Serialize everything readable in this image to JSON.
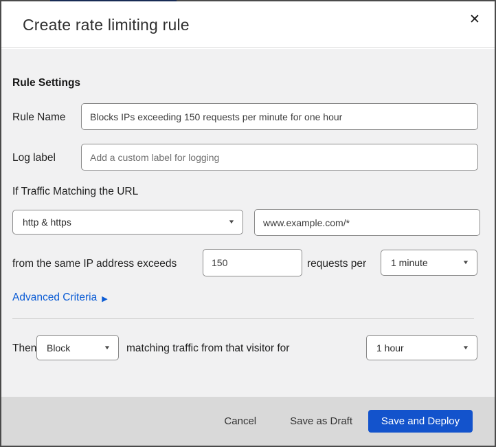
{
  "dialog": {
    "title": "Create rate limiting rule"
  },
  "icons": {
    "close": "✕",
    "caret_down": "▼",
    "arrow_right": "▶"
  },
  "rule_settings": {
    "heading": "Rule Settings",
    "rule_name": {
      "label": "Rule Name",
      "value": "Blocks IPs exceeding 150 requests per minute for one hour"
    },
    "log_label": {
      "label": "Log label",
      "placeholder": "Add a custom label for logging"
    }
  },
  "criteria": {
    "intro": "If Traffic Matching the URL",
    "scheme_select": {
      "selected": "http & https"
    },
    "url_input": {
      "value": "www.example.com/*"
    },
    "threshold_text_before": "from the same IP address exceeds",
    "threshold_input": {
      "value": "150"
    },
    "threshold_text_after": "requests per",
    "period_select": {
      "selected": "1 minute"
    },
    "advanced_link": {
      "label": "Advanced Criteria"
    }
  },
  "action": {
    "then_label": "Then",
    "action_select": {
      "selected": "Block"
    },
    "middle_text": "matching traffic from that visitor for",
    "duration_select": {
      "selected": "1 hour"
    }
  },
  "footer": {
    "cancel": "Cancel",
    "save_draft": "Save as Draft",
    "save_deploy": "Save and Deploy"
  },
  "colors": {
    "accent_top": "#172b54",
    "link_blue": "#0b5cd5",
    "primary_button": "#1353cc",
    "body_bg": "#f1f1f2",
    "footer_bg": "#d9d9d9",
    "dialog_border": "#4a4a4a"
  }
}
